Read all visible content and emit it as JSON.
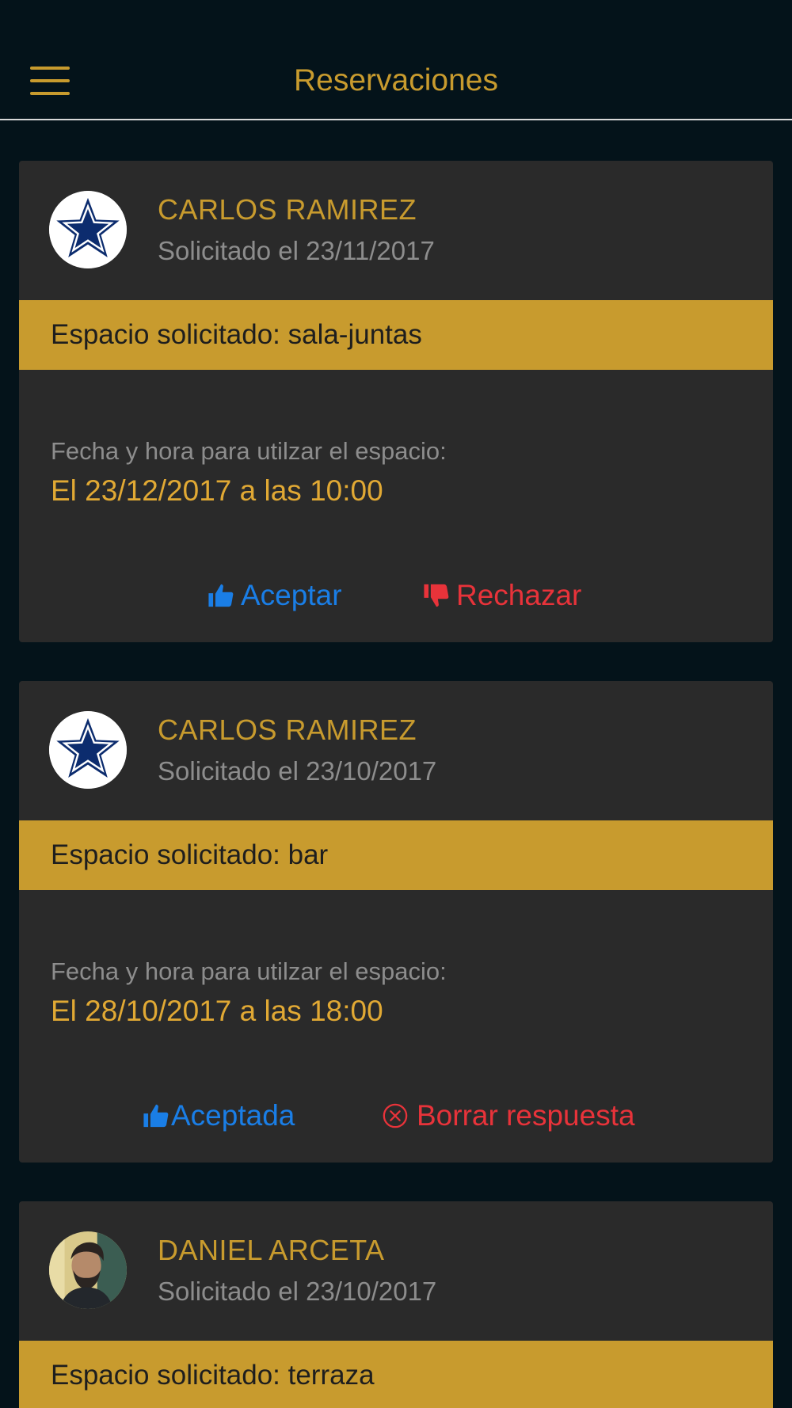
{
  "header": {
    "title": "Reservaciones",
    "menu_icon": "hamburger-menu-icon"
  },
  "colors": {
    "background": "#04131a",
    "card": "#2a2a2a",
    "accent": "#c89b2e",
    "accept": "#1a7ee6",
    "reject": "#e8333a"
  },
  "reservations": [
    {
      "name": "CARLOS RAMIREZ",
      "requested": "Solicitado el 23/11/2017",
      "avatar": "star-logo",
      "space": "Espacio solicitado: sala-juntas",
      "date_label": "Fecha y hora para utilzar el espacio:",
      "date_value": "El 23/12/2017 a las 10:00",
      "primary_action": {
        "label": "Aceptar",
        "icon": "thumbs-up-icon"
      },
      "secondary_action": {
        "label": "Rechazar",
        "icon": "thumbs-down-icon"
      }
    },
    {
      "name": "CARLOS RAMIREZ",
      "requested": "Solicitado el 23/10/2017",
      "avatar": "star-logo",
      "space": "Espacio solicitado: bar",
      "date_label": "Fecha y hora para utilzar el espacio:",
      "date_value": "El 28/10/2017 a las 18:00",
      "primary_action": {
        "label": "Aceptada",
        "icon": "thumbs-up-icon"
      },
      "secondary_action": {
        "label": "Borrar respuesta",
        "icon": "circle-x-icon"
      }
    },
    {
      "name": "DANIEL ARCETA",
      "requested": "Solicitado el 23/10/2017",
      "avatar": "user-photo",
      "space": "Espacio solicitado: terraza"
    }
  ]
}
